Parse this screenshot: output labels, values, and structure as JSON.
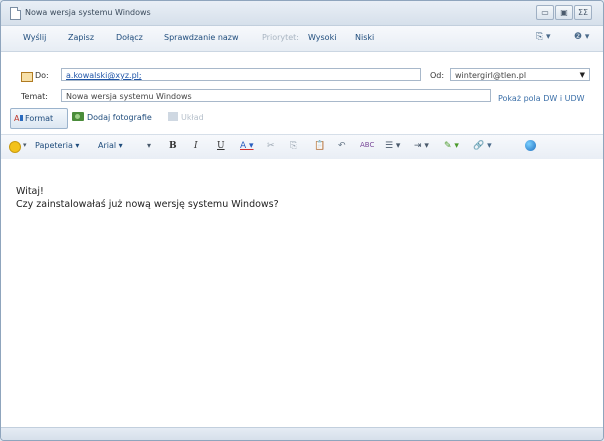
{
  "window": {
    "title": "Nowa wersja systemu Windows"
  },
  "window_controls": {
    "minimize": "▭",
    "maximize": "▣",
    "close": "ΣΣ"
  },
  "menu": {
    "send": "Wyślij",
    "save": "Zapisz",
    "attach": "Dołącz",
    "check_names": "Sprawdzanie nazw",
    "priority": "Priorytet:",
    "high": "Wysoki",
    "low": "Niski",
    "right_icon_1": "⎘ ▾",
    "right_icon_2": "❷ ▾"
  },
  "fields": {
    "to_label": "Do:",
    "to_value": "a.kowalski@xyz.pl;",
    "subject_label": "Temat:",
    "subject_value": "Nowa wersja systemu Windows",
    "from_label": "Od:",
    "from_value": "wintergirl@tlen.pl",
    "cc_link": "Pokaż pola DW i UDW"
  },
  "actions": {
    "format": "Format",
    "add_photos": "Dodaj fotografie",
    "layout": "Układ"
  },
  "format_toolbar": {
    "stationery": "Papeteria ▾",
    "font": "Arial ▾",
    "size": "▾",
    "bold": "B",
    "italic": "I",
    "underline": "U",
    "font_color": "A ▾",
    "cut": "✂",
    "copy": "⎘",
    "paste": "📋",
    "undo": "↶",
    "spelling": "ABC",
    "list": "☰ ▾",
    "indent": "⇥ ▾",
    "highlight": "✎ ▾",
    "link": "🔗 ▾"
  },
  "message": {
    "line1": "Witaj!",
    "line2": "Czy zainstalowałaś już nową wersję systemu Windows?"
  }
}
